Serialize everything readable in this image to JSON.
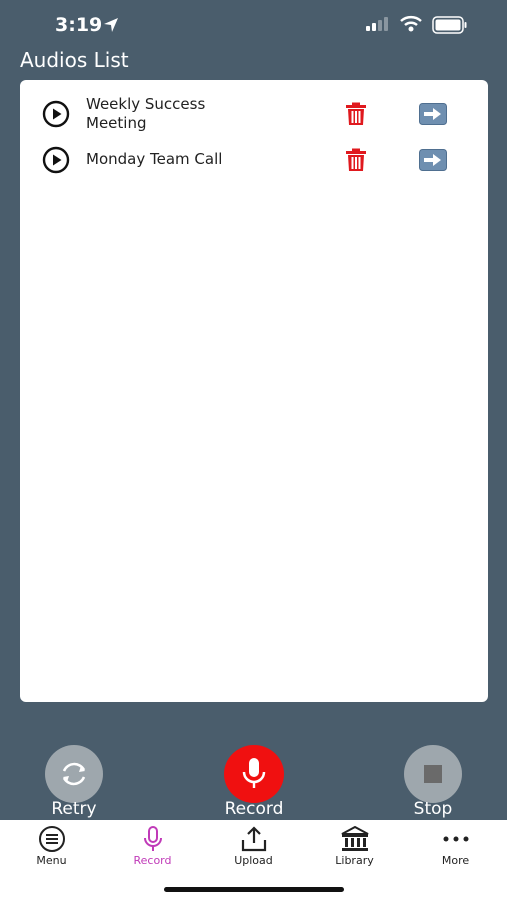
{
  "status_bar": {
    "time": "3:19"
  },
  "header": {
    "title": "Audios List"
  },
  "audios": [
    {
      "title": "Weekly Success Meeting"
    },
    {
      "title": "Monday Team Call"
    }
  ],
  "controls": {
    "retry_label": "Retry",
    "record_label": "Record",
    "stop_label": "Stop"
  },
  "tabs": [
    {
      "label": "Menu",
      "icon": "menu-icon"
    },
    {
      "label": "Record",
      "icon": "mic-icon",
      "active": true
    },
    {
      "label": "Upload",
      "icon": "upload-icon"
    },
    {
      "label": "Library",
      "icon": "library-icon"
    },
    {
      "label": "More",
      "icon": "more-icon"
    }
  ],
  "colors": {
    "background": "#4a5d6c",
    "record_red": "#f01010",
    "active_tab": "#c03ab8",
    "delete_red": "#e0191e",
    "open_button": "#6f8fb0"
  }
}
